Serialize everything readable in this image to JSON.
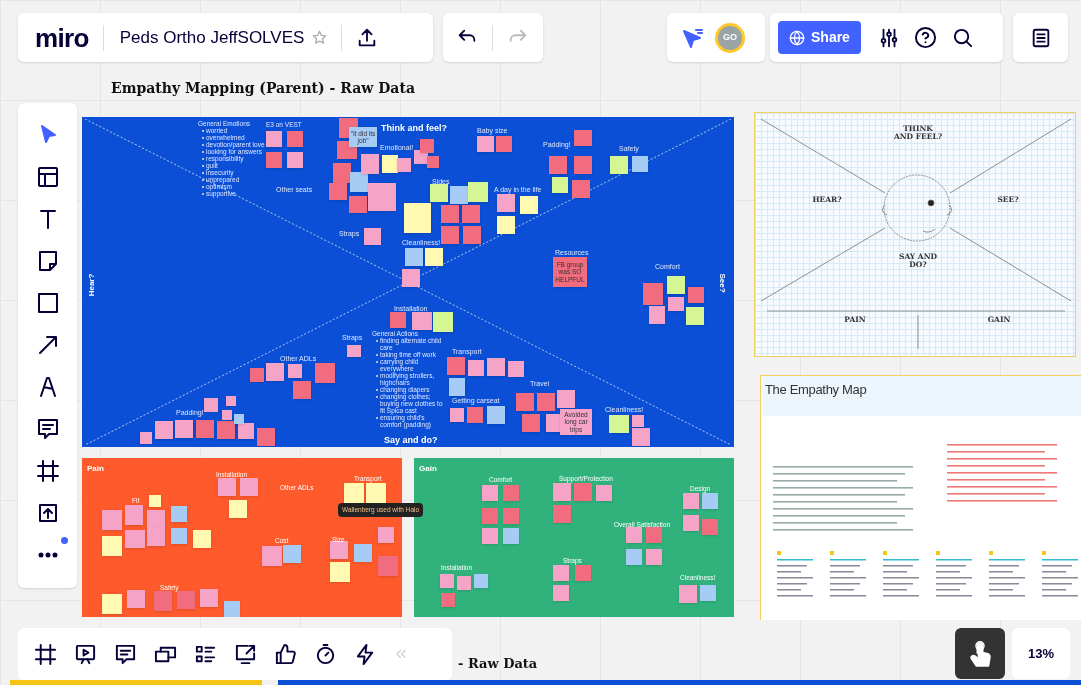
{
  "top_bar": {
    "logo": "miro",
    "board_title": "Peds Ortho JeffSOLVES",
    "starred": false,
    "avatar": "GO",
    "share": "Share"
  },
  "board_heading": "Empathy Mapping (Parent) - Raw Data",
  "empathy_frame": {
    "quadrants": [
      {
        "kind": "top",
        "text": "Think and feel?"
      },
      {
        "kind": "left",
        "text": "Hear?"
      },
      {
        "kind": "right",
        "text": "See?"
      },
      {
        "kind": "bottom",
        "text": "Say and do?"
      }
    ],
    "topics": [
      "Baby size",
      "Emotional!",
      "Padding!",
      "Safety",
      "Other seats",
      "Sides",
      "A day in the life",
      "Straps",
      "Cleanliness!",
      "Resources",
      "Comfort",
      "Installation",
      "Straps",
      "Other ADLs",
      "Transport",
      "Travel",
      "Getting carseat",
      "Padding!",
      "Cleanliness!"
    ],
    "emotions": {
      "heading": "General Emotions",
      "items": [
        "worried",
        "overwhelmed",
        "devotion/parent love",
        "looking for answers",
        "responsibility",
        "guilt",
        "insecurity",
        "unprepared",
        "optimism",
        "supportive"
      ]
    },
    "vest_label": "E3 on VEST",
    "actions": {
      "heading": "General Actions",
      "items": [
        "finding alternate child care",
        "taking time off work",
        "carrying child everywhere",
        "modifying strollers, highchairs",
        "changing diapers",
        "changing clothes; buying new clothes to fit Spica cast",
        "ensuring child's comfort (padding)"
      ]
    },
    "notes": [
      "\"It did its job\"",
      "FB group was SO HELPFUL",
      "Avoided long car trips"
    ]
  },
  "pain_frame": {
    "title": "Pain",
    "topics": [
      "Installation",
      "Other ADLs",
      "Transport",
      "Fit",
      "Cost",
      "Size",
      "Safety"
    ],
    "tooltip": "Wallenberg used with Halo"
  },
  "gain_frame": {
    "title": "Gain",
    "topics": [
      "Comfort",
      "Support/Protection",
      "Design",
      "Overall Satisfaction",
      "Installation",
      "Straps",
      "Cleanliness!"
    ]
  },
  "template": {
    "sections": [
      "THINK AND FEEL?",
      "HEAR?",
      "SEE?",
      "SAY AND DO?",
      "PAIN",
      "GAIN"
    ]
  },
  "empathy_doc": {
    "title": "The Empathy Map"
  },
  "bottom_heading": "- Raw Data",
  "zoom": "13%"
}
